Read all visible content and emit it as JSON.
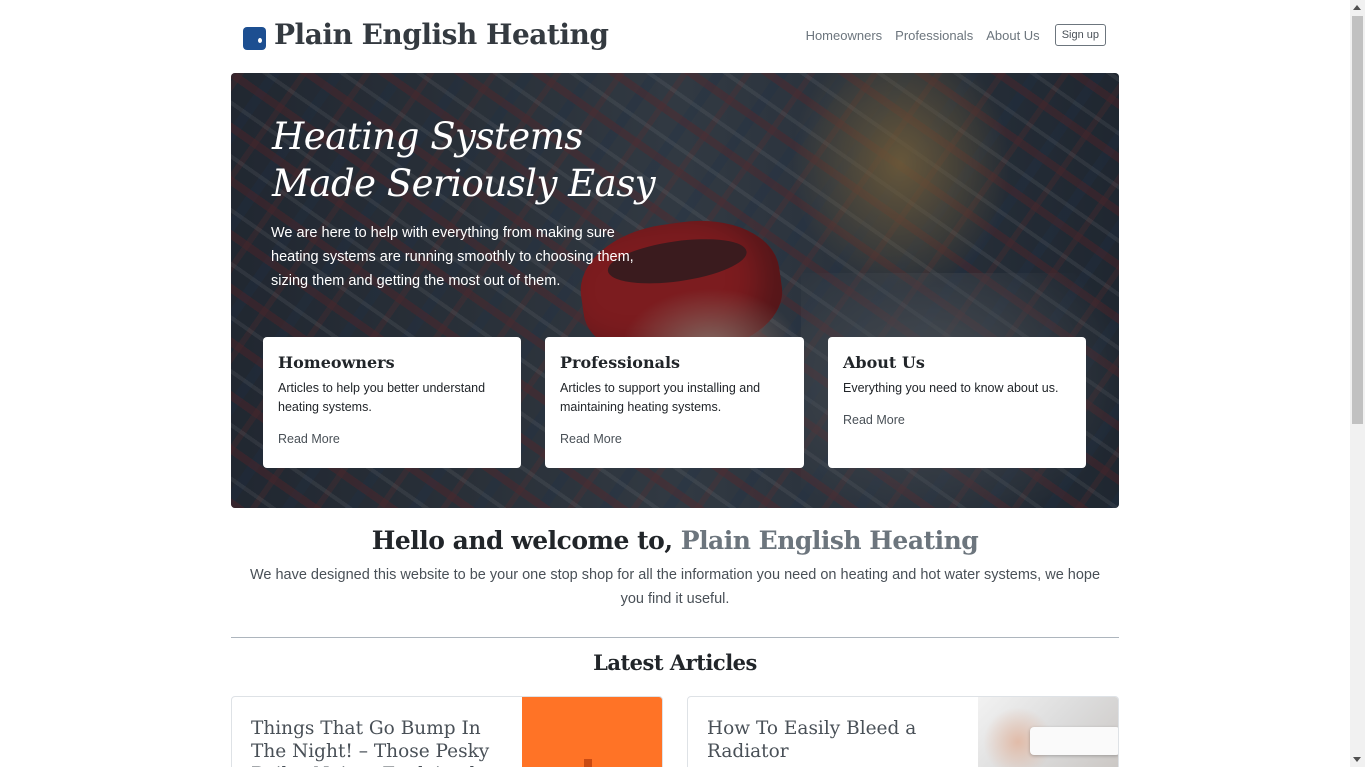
{
  "header": {
    "brand": "Plain English Heating",
    "nav": [
      "Homeowners",
      "Professionals",
      "About Us"
    ],
    "signup": "Sign up"
  },
  "hero": {
    "title": "Heating Systems Made Seriously Easy",
    "lead": "We are here to help with everything from making sure heating systems are running smoothly to choosing them, sizing them and getting the most out of them.",
    "cards": [
      {
        "title": "Homeowners",
        "text": "Articles to help you better understand heating systems.",
        "link": "Read More"
      },
      {
        "title": "Professionals",
        "text": "Articles to support you installing and maintaining heating systems.",
        "link": "Read More"
      },
      {
        "title": "About Us",
        "text": "Everything you need to know about us.",
        "link": "Read More"
      }
    ]
  },
  "welcome": {
    "heading": "Hello and welcome to,",
    "heading_highlight": "Plain English Heating",
    "text": "We have designed this website to be your one stop shop for all the information you need on heating and hot water systems, we hope you find it useful."
  },
  "latest": {
    "heading": "Latest Articles",
    "articles": [
      {
        "title": "Things That Go Bump In The Night! – Those Pesky Boiler Noises Explained"
      },
      {
        "title": "How To Easily Bleed a Radiator"
      }
    ]
  },
  "colors": {
    "brand": "#1d4f91",
    "mug": "#d11f1f",
    "article_thumb": "#ff7326",
    "muted": "#6c757d"
  }
}
